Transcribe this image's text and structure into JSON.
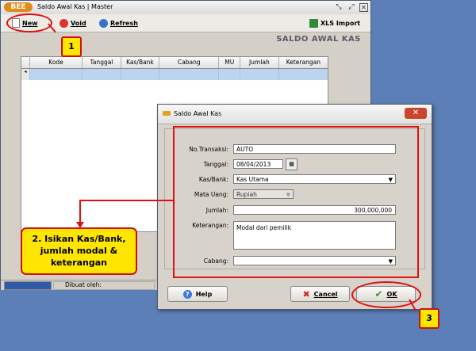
{
  "main_window": {
    "logo": "BEE",
    "title": "Saldo Awal Kas | Master",
    "section_title": "SALDO AWAL KAS",
    "toolbar": {
      "new_label": "New",
      "void_label": "Void",
      "refresh_label": "Refresh",
      "xls_label": "XLS Import"
    },
    "grid_columns": [
      "Kode",
      "Tanggal",
      "Kas/Bank",
      "Cabang",
      "MU",
      "Jumlah",
      "Keterangan"
    ],
    "status": {
      "created_by_label": "Dibuat oleh:"
    }
  },
  "dialog": {
    "title": "Saldo Awal Kas",
    "fields": {
      "no_transaksi": {
        "label": "No.Transaksi:",
        "value": "AUTO"
      },
      "tanggal": {
        "label": "Tanggal:",
        "value": "08/04/2013"
      },
      "kas_bank": {
        "label": "Kas/Bank:",
        "value": "Kas Utama"
      },
      "mata_uang": {
        "label": "Mata Uang:",
        "value": "Rupiah"
      },
      "jumlah": {
        "label": "Jumlah:",
        "value": "300,000,000"
      },
      "keterangan": {
        "label": "Keterangan:",
        "value": "Modal dari pemilik"
      },
      "cabang": {
        "label": "Cabang:",
        "value": ""
      }
    },
    "buttons": {
      "help": "Help",
      "cancel": "Cancel",
      "ok": "OK"
    }
  },
  "annotations": {
    "badge_1": "1",
    "badge_3": "3",
    "callout_lines": [
      "2. Isikan Kas/Bank,",
      "jumlah modal &",
      "keterangan"
    ]
  },
  "colors": {
    "annotation_red": "#e01010",
    "callout_yellow": "#ffe600",
    "desktop_blue": "#5b7fb6",
    "grid_selection": "#bcd5ef"
  }
}
